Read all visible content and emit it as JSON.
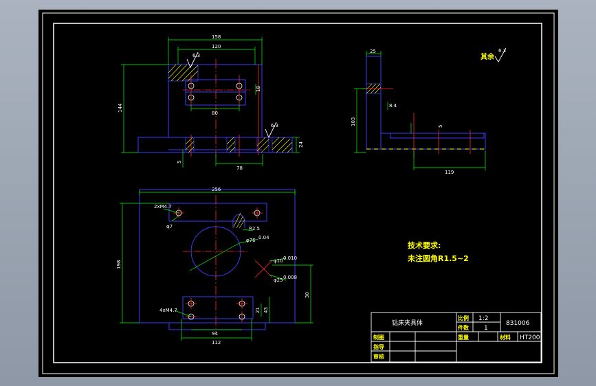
{
  "colors": {
    "background": "#000000",
    "frame": "#ffffff",
    "outline": "#3c3cff",
    "dimension": "#00ff00",
    "centerline": "#ff2a2a",
    "hatch": "#ffff00",
    "text": "#ffffff",
    "note": "#ffff00"
  },
  "roughness": {
    "label": "其余",
    "value": "6.3",
    "symbol_value": "6.3"
  },
  "front_view": {
    "dims": {
      "width_158": "158",
      "width_120": "120",
      "height_144": "144",
      "hole_spacing_80": "80",
      "height_18": "18",
      "dim_78": "78",
      "dim_5": "5",
      "dim_24": "24",
      "rough_a": "6.3",
      "rough_b": "6.3"
    }
  },
  "side_view": {
    "dims": {
      "dim_25": "25",
      "dim_103": "103",
      "dim_5": "5",
      "dim_119": "119",
      "dim_8_4": "8.4"
    }
  },
  "top_view": {
    "dims": {
      "width_256": "256",
      "holes_top": "2xM4.7",
      "dia_7": "φ7",
      "r_25": "R2.5",
      "dia_76": "φ76",
      "dia_76_tol": "0.04",
      "dia_10": "φ10",
      "dia_10_tol": "0.010",
      "dia_25": "φ25",
      "dia_25_tol": "0.008",
      "height_198": "198",
      "holes_bottom": "4xM4.7",
      "dim_94": "94",
      "dim_112": "112",
      "dim_21": "21",
      "dim_43": "43",
      "dim_30": "30"
    }
  },
  "tech_requirements": {
    "title": "技术要求:",
    "line1": "未注圆角R1.5~2"
  },
  "title_block": {
    "part_name": "钻床夹具体",
    "scale_label": "比例",
    "scale_value": "1:2",
    "qty_label": "件数",
    "qty_value": "1",
    "drawing_no": "831006",
    "drawn_label": "制图",
    "weight_label": "重量",
    "material_label": "材料",
    "material_value": "HT200",
    "designer_label": "指导",
    "reviewer_label": "审核"
  }
}
